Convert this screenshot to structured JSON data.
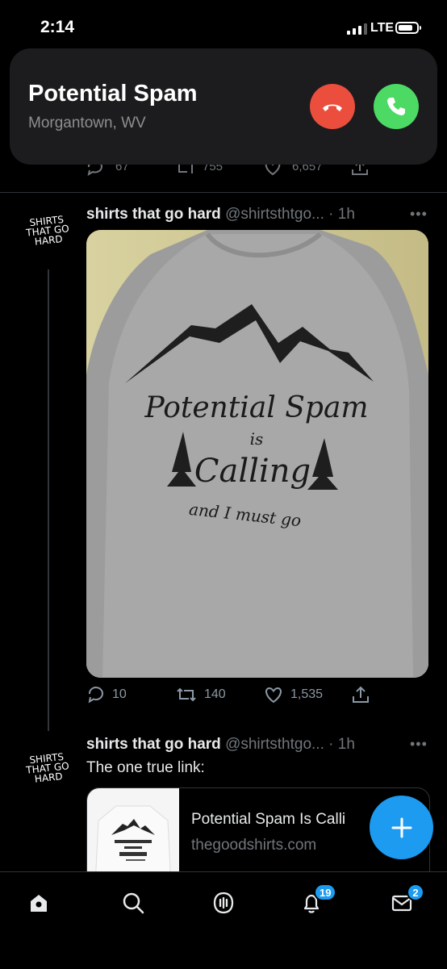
{
  "status_bar": {
    "time": "2:14",
    "network": "LTE"
  },
  "incoming_call": {
    "caller": "Potential Spam",
    "location": "Morgantown, WV"
  },
  "previous_tweet": {
    "replies": "67",
    "retweets": "755",
    "likes": "6,657"
  },
  "tweet1": {
    "avatar_text": [
      "SHIRTS",
      "THAT GO",
      "HARD"
    ],
    "name": "shirts that go hard",
    "handle": "@shirtsthtgo...",
    "age": "· 1h",
    "shirt_print": {
      "line1": "Potential Spam",
      "line2": "is",
      "line3": "Calling",
      "line4": "and I must go"
    },
    "replies": "10",
    "retweets": "140",
    "likes": "1,535"
  },
  "tweet2": {
    "avatar_text": [
      "SHIRTS",
      "THAT GO",
      "HARD"
    ],
    "name": "shirts that go hard",
    "handle": "@shirtsthtgo...",
    "age": "· 1h",
    "text": "The one true link:",
    "link_card": {
      "title": "Potential Spam Is Calli",
      "domain": "thegoodshirts.com"
    }
  },
  "tab_bar": {
    "tabs": [
      "home-icon",
      "search-icon",
      "spaces-icon",
      "notifications-icon",
      "messages-icon"
    ],
    "notifications_badge": "19",
    "messages_badge": "2"
  },
  "colors": {
    "accent": "#1d9bf0",
    "decline": "#eb4e3d",
    "accept": "#4cd964",
    "background": "#000000"
  }
}
